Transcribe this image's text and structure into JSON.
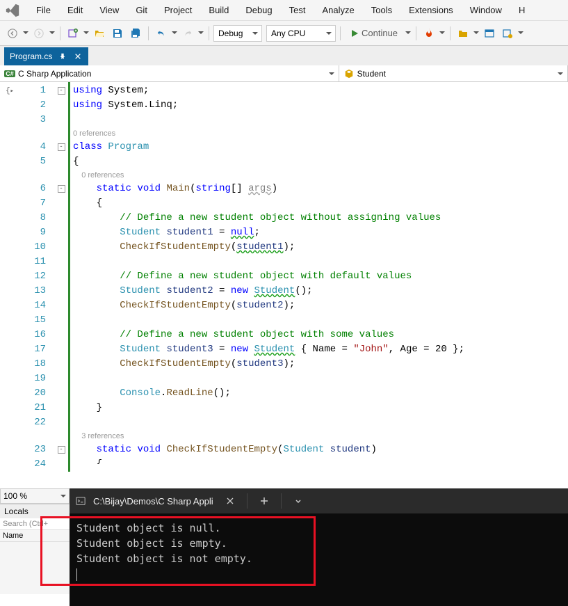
{
  "menu": [
    "File",
    "Edit",
    "View",
    "Git",
    "Project",
    "Build",
    "Debug",
    "Test",
    "Analyze",
    "Tools",
    "Extensions",
    "Window",
    "H"
  ],
  "toolbar": {
    "config": "Debug",
    "platform": "Any CPU",
    "continue": "Continue"
  },
  "tab": {
    "title": "Program.cs"
  },
  "nav": {
    "project": "C Sharp Application",
    "member": "Student"
  },
  "zoom": "100 %",
  "locals": {
    "title": "Locals",
    "search": "Search (Ctrl+",
    "col1": "Name"
  },
  "terminal": {
    "title": "C:\\Bijay\\Demos\\C Sharp Appli",
    "lines": [
      "Student object is null.",
      "Student object is empty.",
      "Student object is not empty."
    ]
  },
  "code": {
    "lines": [
      {
        "n": 1,
        "fold": "-",
        "html": "<span class='kw'>using</span> System;"
      },
      {
        "n": 2,
        "html": "<span class='kw'>using</span> System.Linq;"
      },
      {
        "n": 3,
        "html": ""
      },
      {
        "codelens": "0 references",
        "indent": 0
      },
      {
        "n": 4,
        "fold": "-",
        "html": "<span class='kw'>class</span> <span class='type'>Program</span>"
      },
      {
        "n": 5,
        "html": "{"
      },
      {
        "codelens": "0 references",
        "indent": 1
      },
      {
        "n": 6,
        "fold": "-",
        "html": "    <span class='kw'>static</span> <span class='kw'>void</span> <span class='method'>Main</span>(<span class='kw'>string</span>[] <span class='param'>args</span>)"
      },
      {
        "n": 7,
        "html": "    {"
      },
      {
        "n": 8,
        "html": "        <span class='comment'>// Define a new student object without assigning values</span>"
      },
      {
        "n": 9,
        "html": "        <span class='type'>Student</span> <span class='ident'>student1</span> = <span class='kw squiggle'>null</span>;"
      },
      {
        "n": 10,
        "html": "        <span class='method'>CheckIfStudentEmpty</span>(<span class='ident squiggle'>student1</span>);"
      },
      {
        "n": 11,
        "html": ""
      },
      {
        "n": 12,
        "html": "        <span class='comment'>// Define a new student object with default values</span>"
      },
      {
        "n": 13,
        "html": "        <span class='type'>Student</span> <span class='ident'>student2</span> = <span class='kw'>new</span> <span class='type squiggle'>Student</span>();"
      },
      {
        "n": 14,
        "html": "        <span class='method'>CheckIfStudentEmpty</span>(<span class='ident'>student2</span>);"
      },
      {
        "n": 15,
        "html": ""
      },
      {
        "n": 16,
        "html": "        <span class='comment'>// Define a new student object with some values</span>"
      },
      {
        "n": 17,
        "html": "        <span class='type'>Student</span> <span class='ident'>student3</span> = <span class='kw'>new</span> <span class='type squiggle'>Student</span> { Name = <span class='str'>\"John\"</span>, Age = 20 };"
      },
      {
        "n": 18,
        "html": "        <span class='method'>CheckIfStudentEmpty</span>(<span class='ident'>student3</span>);"
      },
      {
        "n": 19,
        "html": ""
      },
      {
        "n": 20,
        "html": "        <span class='type'>Console</span>.<span class='method'>ReadLine</span>();"
      },
      {
        "n": 21,
        "html": "    }"
      },
      {
        "n": 22,
        "html": ""
      },
      {
        "codelens": "3 references",
        "indent": 1
      },
      {
        "n": 23,
        "fold": "-",
        "html": "    <span class='kw'>static</span> <span class='kw'>void</span> <span class='method'>CheckIfStudentEmpty</span>(<span class='type'>Student</span> <span class='ident'>student</span>)"
      },
      {
        "n": 24,
        "partial": true,
        "html": "    {"
      }
    ]
  }
}
